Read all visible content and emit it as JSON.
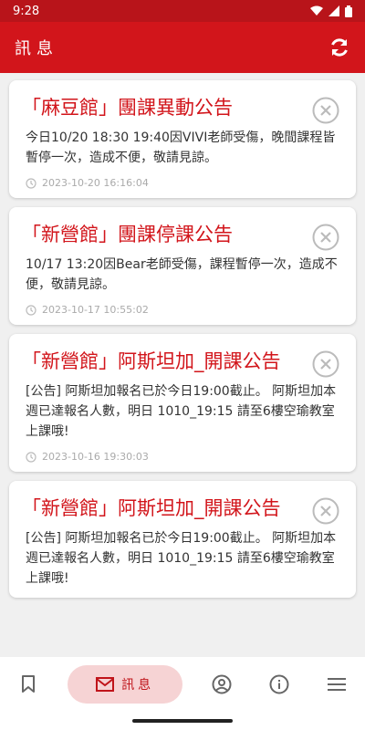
{
  "status_bar": {
    "time": "9:28"
  },
  "app_bar": {
    "title": "訊息"
  },
  "announcements": [
    {
      "title": "「麻豆館」團課異動公告",
      "body": "今日10/20 18:30 19:40因VIVI老師受傷，晚間課程皆暫停一次，造成不便，敬請見諒。",
      "time": "2023-10-20 16:16:04"
    },
    {
      "title": "「新營館」團課停課公告",
      "body": "10/17 13:20因Bear老師受傷，課程暫停一次，造成不便，敬請見諒。",
      "time": "2023-10-17 10:55:02"
    },
    {
      "title": "「新營館」阿斯坦加_開課公告",
      "body": "[公告] 阿斯坦加報名已於今日19:00截止。 阿斯坦加本週已達報名人數，明日 1010_19:15 請至6樓空瑜教室上課哦!",
      "time": "2023-10-16 19:30:03"
    },
    {
      "title": "「新營館」阿斯坦加_開課公告",
      "body": "[公告] 阿斯坦加報名已於今日19:00截止。 阿斯坦加本週已達報名人數，明日 1010_19:15 請至6樓空瑜教室上課哦!",
      "time": ""
    }
  ],
  "bottom_nav": {
    "active_label": "訊息"
  },
  "colors": {
    "primary": "#d2151b",
    "status_bar": "#b8141a",
    "active_pill": "#f6d3d4"
  }
}
